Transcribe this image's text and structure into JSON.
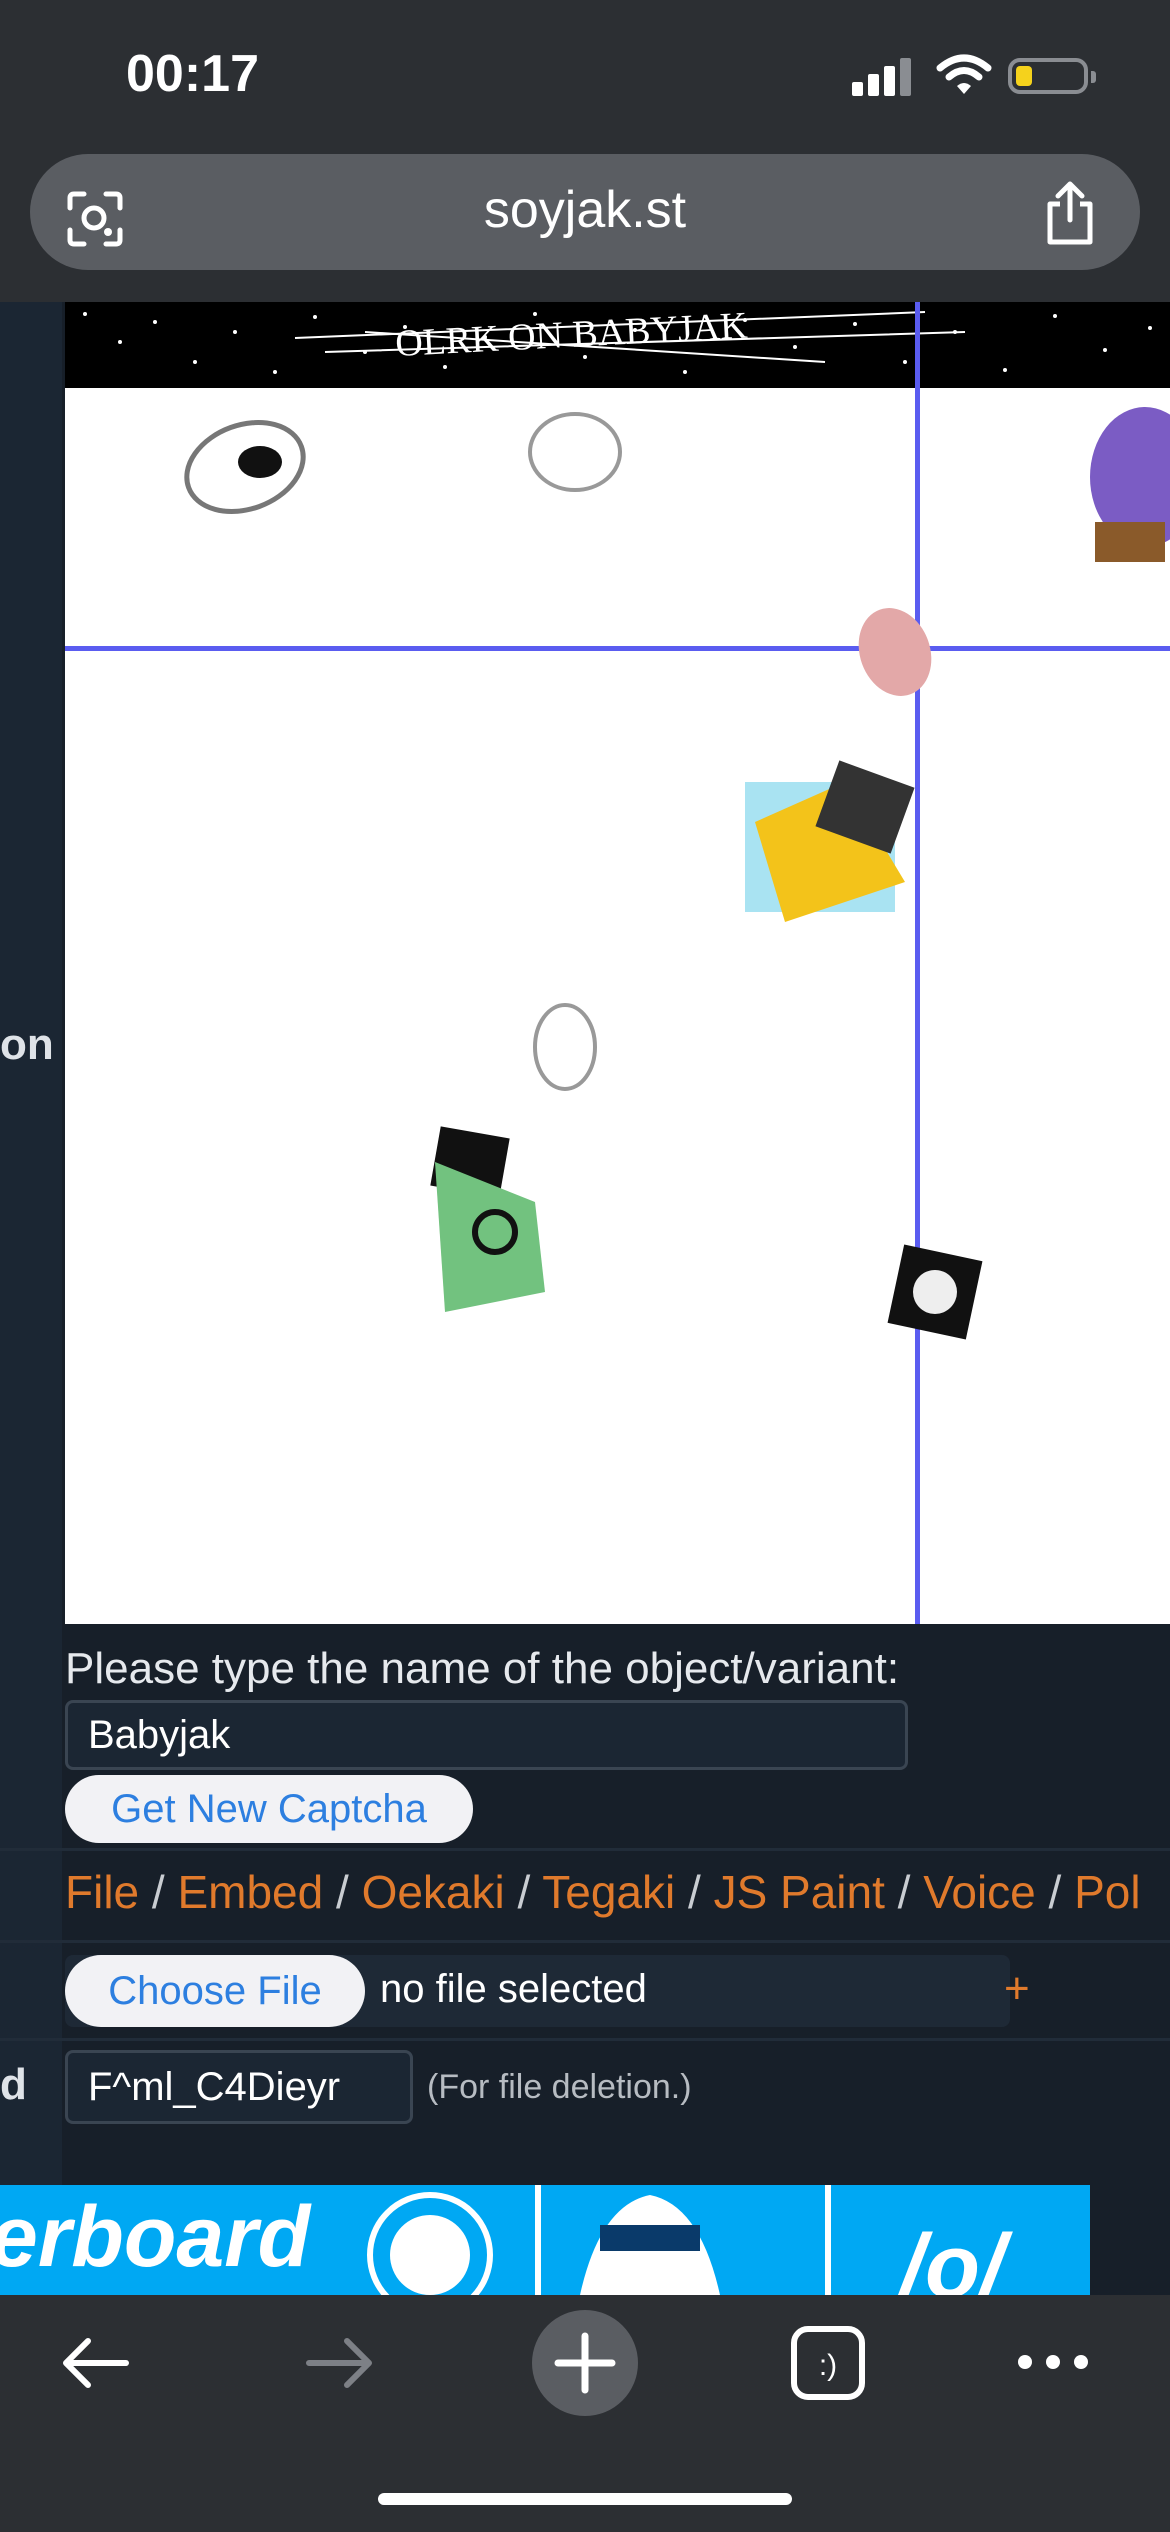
{
  "status": {
    "time": "00:17"
  },
  "browser": {
    "url": "soyjak.st"
  },
  "sidebar": {
    "fragment_top": "on",
    "fragment_bottom": "d"
  },
  "captcha": {
    "header_text": "OLRK ON BABYJAK",
    "prompt": "Please type the name of the object/variant:",
    "answer": "Babyjak",
    "new_button": "Get New Captcha"
  },
  "attach_tabs": [
    "File",
    "Embed",
    "Oekaki",
    "Tegaki",
    "JS Paint",
    "Voice",
    "Pol"
  ],
  "file": {
    "choose_label": "Choose File",
    "status": "no file selected",
    "add_label": "+"
  },
  "password": {
    "value": "F^ml_C4Dieyr",
    "note": "(For file deletion.)"
  },
  "banner": {
    "text": "erboard",
    "fragment": "/o/"
  },
  "colors": {
    "link": "#e07a2c",
    "accent_line": "#5a5cf0",
    "banner": "#00a8f3",
    "page_bg": "#171f29"
  }
}
